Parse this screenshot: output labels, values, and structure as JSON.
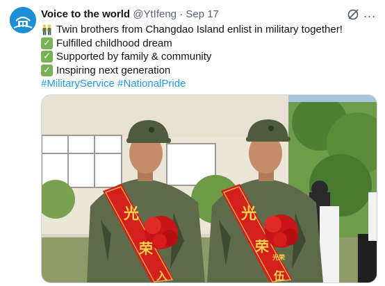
{
  "tweet": {
    "author_name": "Voice to the world",
    "handle": "@YtIfeng",
    "separator": "·",
    "date": "Sep 17",
    "more_icon": "...",
    "lines": [
      {
        "icon": "people-holding-hands-icon",
        "text": "Twin brothers from Changdao Island enlist in military together!"
      },
      {
        "icon": "check-mark-icon",
        "text": "Fulfilled childhood dream"
      },
      {
        "icon": "check-mark-icon",
        "text": "Supported by family & community"
      },
      {
        "icon": "check-mark-icon",
        "text": "Inspiring next generation"
      }
    ],
    "hashtags": [
      "#MilitaryService",
      "#NationalPride"
    ],
    "image": {
      "sash_text": [
        "光",
        "荣",
        "入",
        "伍"
      ],
      "sash_text_small": "光荣"
    }
  },
  "colors": {
    "accent": "#1d9bf0",
    "check_green": "#77b255",
    "sash_red": "#d4201c",
    "text_muted": "#536471"
  }
}
